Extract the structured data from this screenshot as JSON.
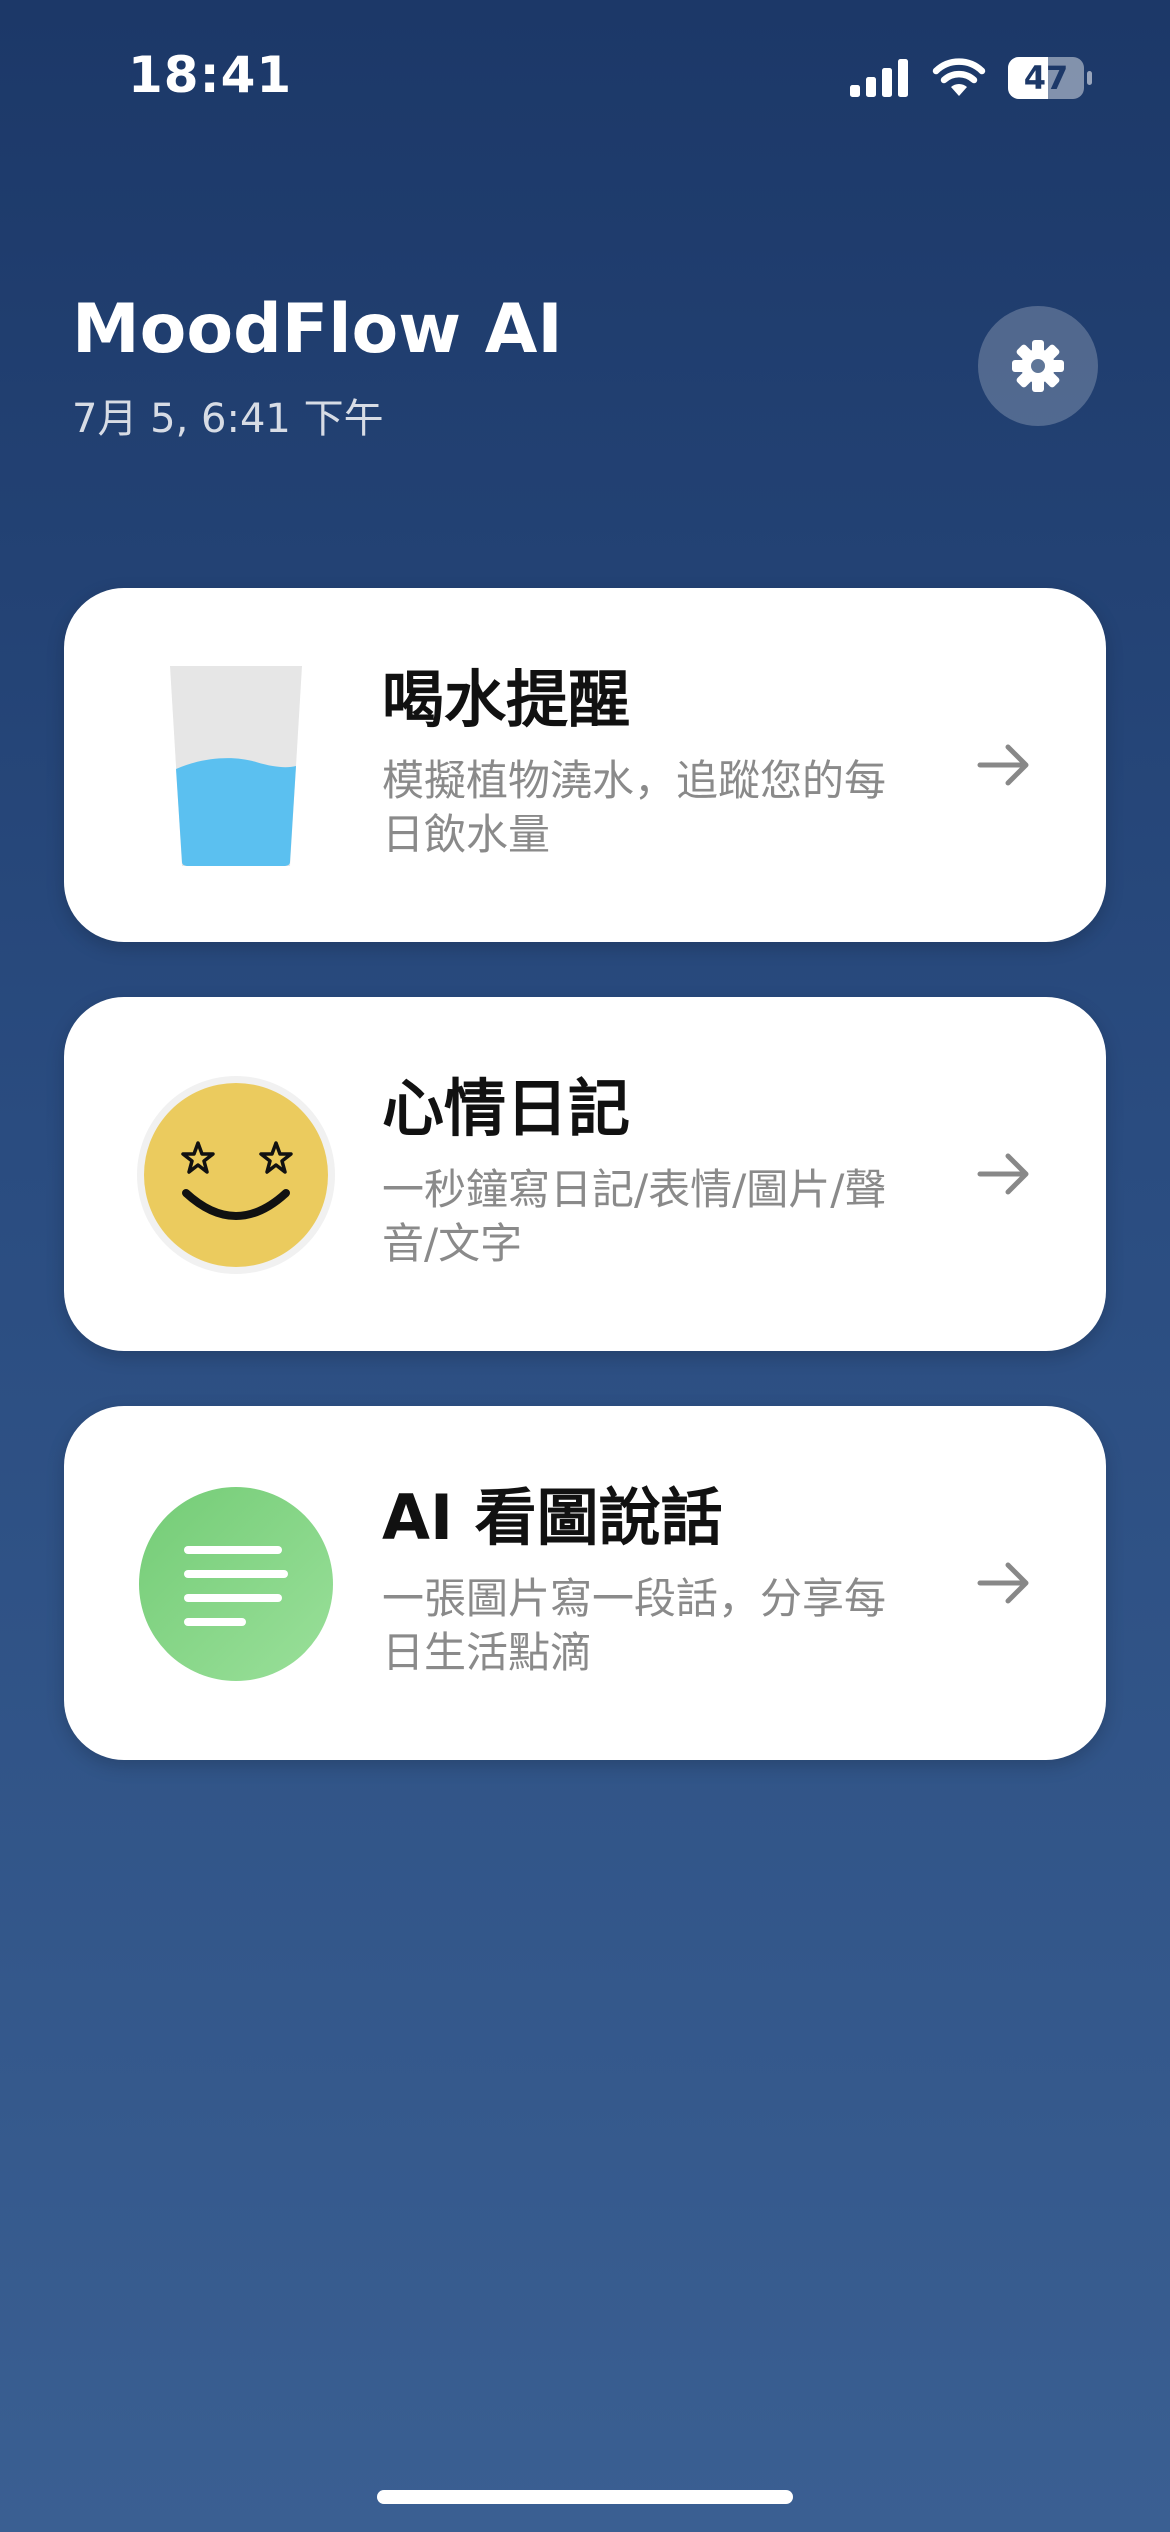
{
  "status_bar": {
    "time": "18:41",
    "battery": "47",
    "icons": [
      "signal-icon",
      "wifi-icon",
      "battery-icon"
    ]
  },
  "header": {
    "title": "MoodFlow AI",
    "date": "7月 5, 6:41 下午",
    "settings_icon": "gear-icon"
  },
  "cards": [
    {
      "title": "喝水提醒",
      "description": "模擬植物澆水，追蹤您的每日飲水量",
      "icon": "water-glass-icon",
      "arrow_icon": "arrow-right-icon"
    },
    {
      "title": "心情日記",
      "description": "一秒鐘寫日記/表情/圖片/聲音/文字",
      "icon": "star-eyes-smiley-icon",
      "arrow_icon": "arrow-right-icon"
    },
    {
      "title": "AI 看圖說話",
      "description": "一張圖片寫一段話，分享每日生活點滴",
      "icon": "text-lines-icon",
      "arrow_icon": "arrow-right-icon"
    }
  ],
  "colors": {
    "background_top": "#1c3868",
    "background_bottom": "#3a5f92",
    "card": "#ffffff",
    "water": "#5bc0f0",
    "smiley": "#ebcb5e",
    "text_lines_bubble": "#7dd07e",
    "arrow": "#888888"
  }
}
